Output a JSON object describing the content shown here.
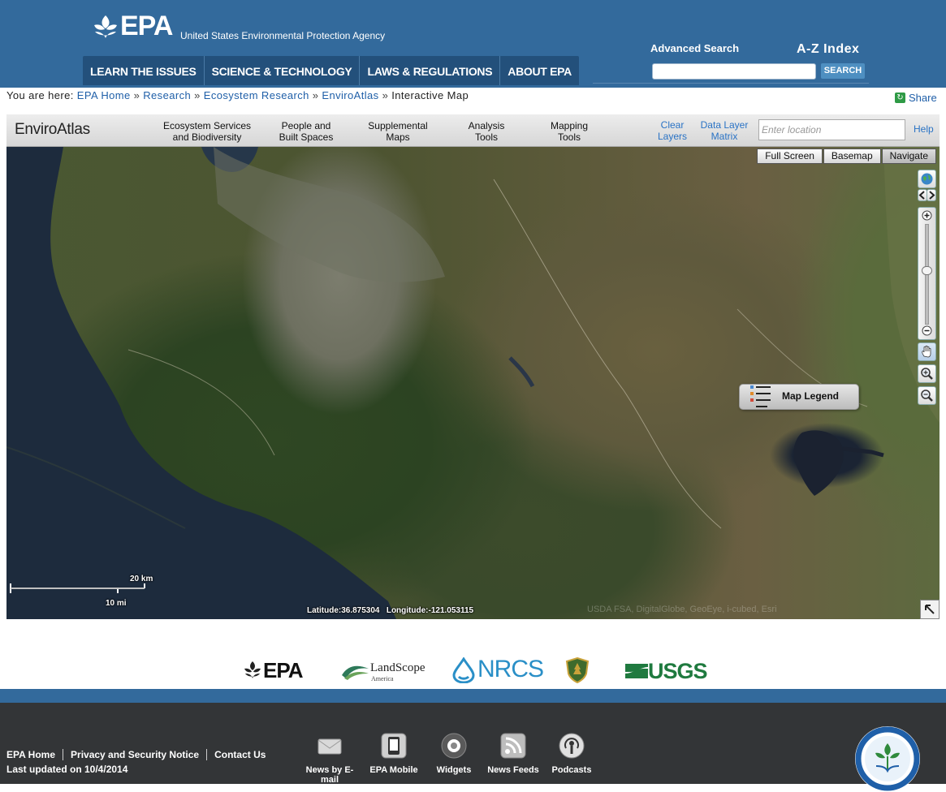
{
  "header": {
    "logo_text": "EPA",
    "agency_name": "United States Environmental Protection Agency",
    "nav": [
      "LEARN THE ISSUES",
      "SCIENCE & TECHNOLOGY",
      "LAWS & REGULATIONS",
      "ABOUT EPA"
    ],
    "advanced_search": "Advanced Search",
    "az_index": "A-Z Index",
    "search_placeholder": "",
    "search_button": "SEARCH"
  },
  "breadcrumb": {
    "prefix": "You are here:",
    "items": [
      "EPA Home",
      "Research",
      "Ecosystem Research",
      "EnviroAtlas"
    ],
    "separator": "»",
    "current": "Interactive Map",
    "share": "Share"
  },
  "app": {
    "title": "EnviroAtlas",
    "menu": [
      {
        "line1": "Ecosystem Services",
        "line2": "and Biodiversity"
      },
      {
        "line1": "People and",
        "line2": "Built Spaces"
      },
      {
        "line1": "Supplemental",
        "line2": "Maps"
      },
      {
        "line1": "Analysis",
        "line2": "Tools"
      },
      {
        "line1": "Mapping",
        "line2": "Tools"
      }
    ],
    "clear_layers": {
      "line1": "Clear",
      "line2": "Layers"
    },
    "data_layer_matrix": {
      "line1": "Data Layer",
      "line2": "Matrix"
    },
    "location_placeholder": "Enter location",
    "help": "Help"
  },
  "map": {
    "buttons": [
      "Full Screen",
      "Basemap",
      "Navigate"
    ],
    "active_button": "Navigate",
    "legend": "Map Legend",
    "scale_km": "20 km",
    "scale_mi": "10 mi",
    "latitude_label": "Latitude:",
    "latitude": "36.875304",
    "longitude_label": "Longitude:",
    "longitude": "-121.053115",
    "attribution": "USDA FSA, DigitalGlobe, GeoEye, i-cubed, Esri"
  },
  "partners": [
    "EPA",
    "LandScope",
    "America",
    "NRCS",
    "USGS"
  ],
  "footer": {
    "links": [
      "EPA Home",
      "Privacy and Security Notice",
      "Contact Us"
    ],
    "updated": "Last updated on 10/4/2014",
    "tools": [
      "News by E-mail",
      "EPA Mobile",
      "Widgets",
      "News Feeds",
      "Podcasts"
    ]
  },
  "colors": {
    "header_blue": "#336a9c",
    "nav_dark": "#23507b",
    "link_blue": "#1f5fa8",
    "footer_dark": "#333537"
  }
}
